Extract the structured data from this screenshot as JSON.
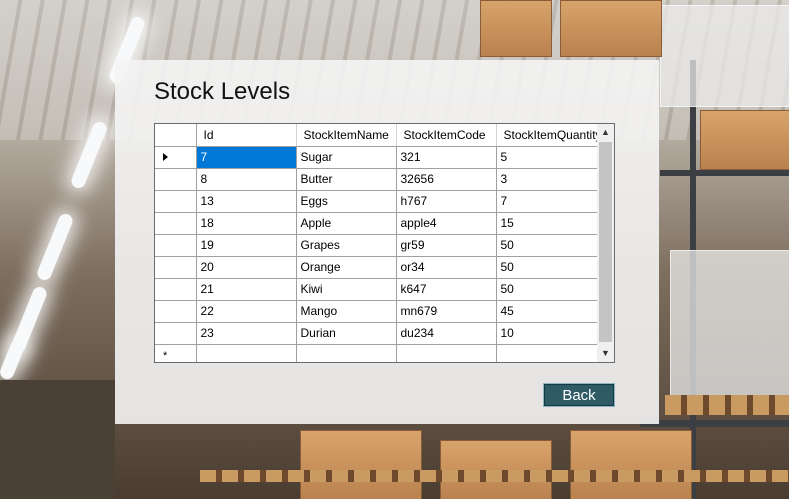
{
  "page": {
    "title": "Stock Levels"
  },
  "grid": {
    "columns": [
      "Id",
      "StockItemName",
      "StockItemCode",
      "StockItemQuantity"
    ],
    "rows": [
      [
        "7",
        "Sugar",
        "321",
        "5"
      ],
      [
        "8",
        "Butter",
        "32656",
        "3"
      ],
      [
        "13",
        "Eggs",
        "h767",
        "7"
      ],
      [
        "18",
        "Apple",
        "apple4",
        "15"
      ],
      [
        "19",
        "Grapes",
        "gr59",
        "50"
      ],
      [
        "20",
        "Orange",
        "or34",
        "50"
      ],
      [
        "21",
        "Kiwi",
        "k647",
        "50"
      ],
      [
        "22",
        "Mango",
        "mn679",
        "45"
      ],
      [
        "23",
        "Durian",
        "du234",
        "10"
      ]
    ],
    "current_row_index": 0,
    "selected_cell": {
      "row": 0,
      "column": 0
    },
    "new_row_glyph": "*",
    "selection_color": "#0078d7",
    "scroll_up_icon": "▲",
    "scroll_down_icon": "▼"
  },
  "actions": {
    "back_label": "Back",
    "back_color": "#2e5b66"
  }
}
